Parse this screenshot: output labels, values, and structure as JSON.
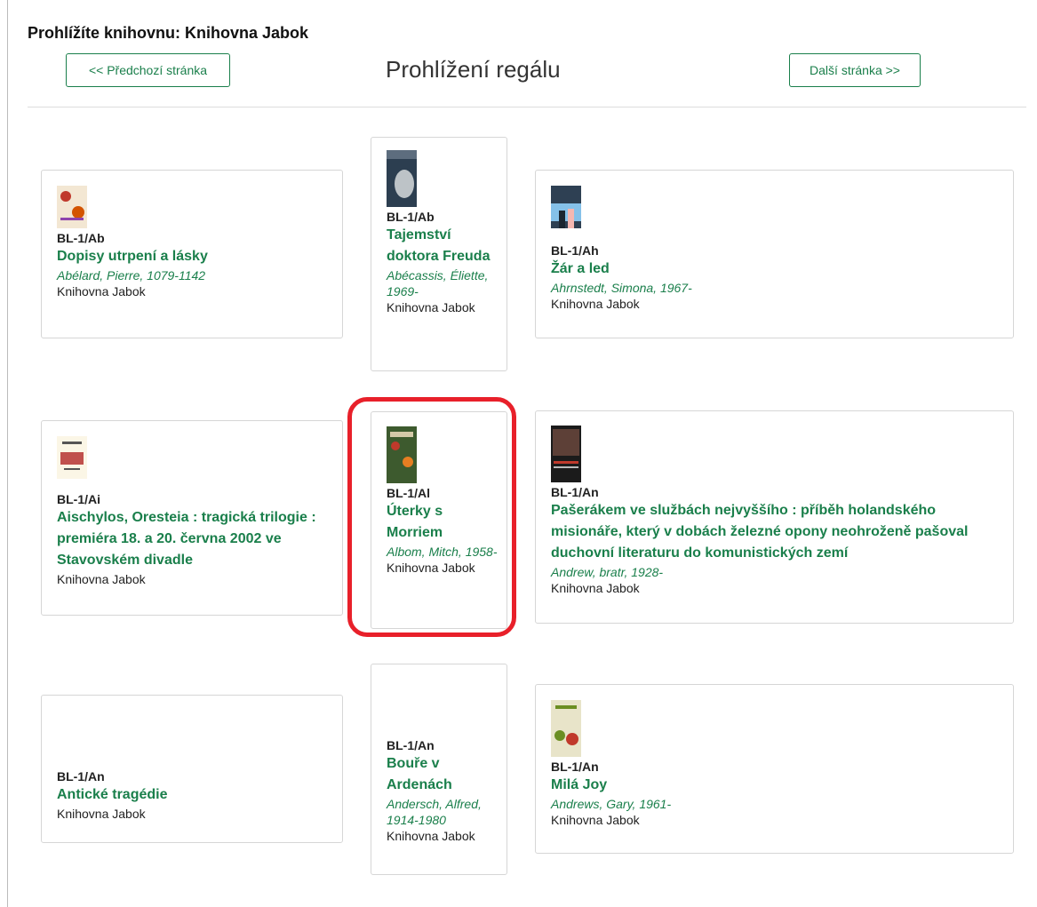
{
  "library_heading": "Prohlížíte knihovnu: Knihovna Jabok",
  "page_title": "Prohlížení regálu",
  "nav": {
    "prev": "<< Předchozí stránka",
    "next": "Další stránka >>"
  },
  "books": [
    {
      "shelfmark": "BL-1/Ab",
      "title": "Dopisy utrpení a lásky",
      "author": "Abélard, Pierre, 1079-1142",
      "library": "Knihovna Jabok"
    },
    {
      "shelfmark": "BL-1/Ab",
      "title": "Tajemství doktora Freuda",
      "author": "Abécassis, Éliette, 1969-",
      "library": "Knihovna Jabok"
    },
    {
      "shelfmark": "BL-1/Ah",
      "title": "Žár a led",
      "author": "Ahrnstedt, Simona, 1967-",
      "library": "Knihovna Jabok"
    },
    {
      "shelfmark": "BL-1/Ai",
      "title": "Aischylos, Oresteia : tragická trilogie : premiéra 18. a 20. června 2002 ve Stavovském divadle",
      "author": "",
      "library": "Knihovna Jabok"
    },
    {
      "shelfmark": "BL-1/Al",
      "title": "Úterky s Morriem",
      "author": "Albom, Mitch, 1958-",
      "library": "Knihovna Jabok"
    },
    {
      "shelfmark": "BL-1/An",
      "title": "Pašerákem ve službách nejvyššího : příběh holandského misionáře, který v dobách železné opony neohroženě pašoval duchovní literaturu do komunistických zemí",
      "author": "Andrew, bratr, 1928-",
      "library": "Knihovna Jabok"
    },
    {
      "shelfmark": "BL-1/An",
      "title": "Antické tragédie",
      "author": "",
      "library": "Knihovna Jabok"
    },
    {
      "shelfmark": "BL-1/An",
      "title": "Bouře v Ardenách",
      "author": "Andersch, Alfred, 1914-1980",
      "library": "Knihovna Jabok"
    },
    {
      "shelfmark": "BL-1/An",
      "title": "Milá Joy",
      "author": "Andrews, Gary, 1961-",
      "library": "Knihovna Jabok"
    }
  ],
  "colors": {
    "accent": "#1a7f4b",
    "highlight": "#e8202a"
  }
}
